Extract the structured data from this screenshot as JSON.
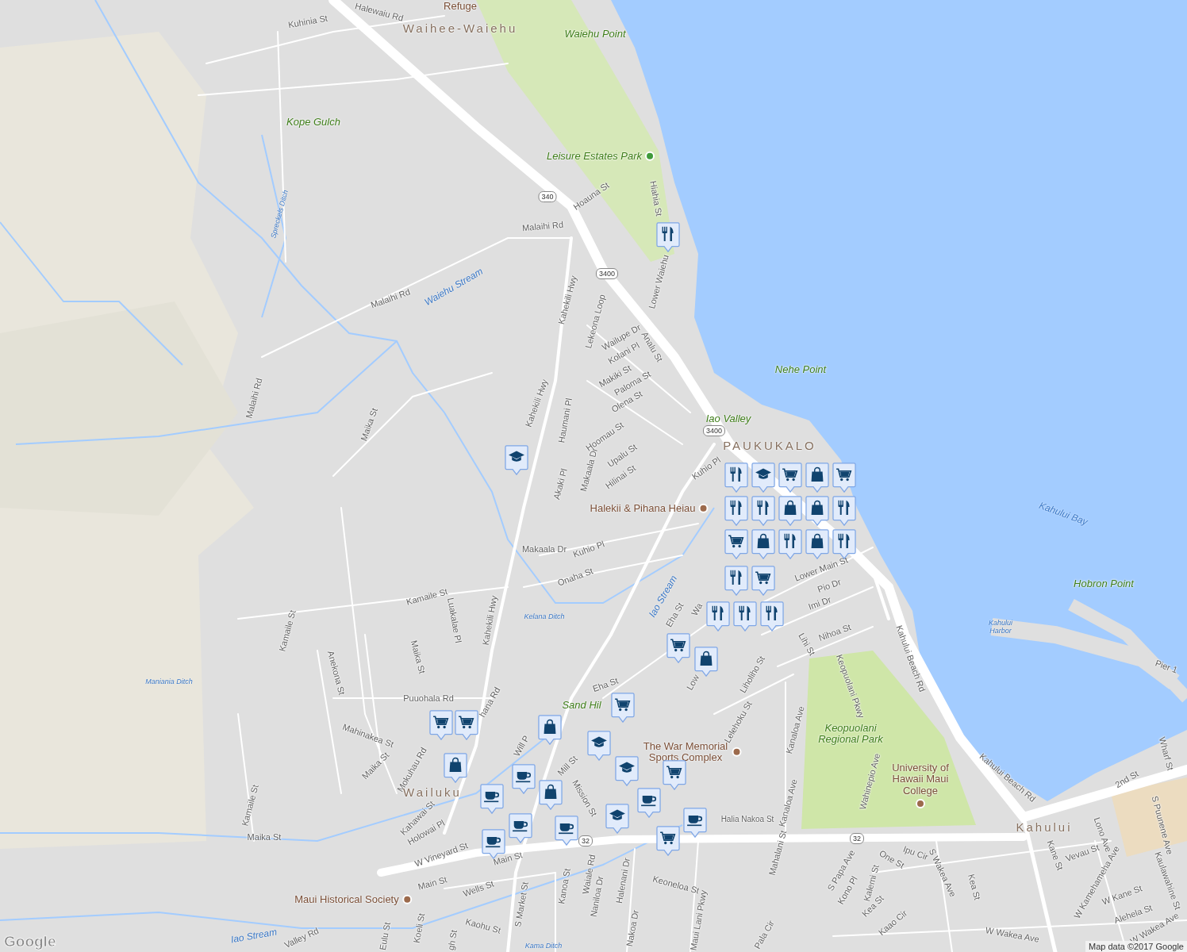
{
  "labels": [
    {
      "kind": "street",
      "text": "Halewaiu Rd"
    },
    {
      "kind": "poi_plain",
      "text": "Refuge"
    },
    {
      "kind": "street",
      "text": "Kuhinia St"
    },
    {
      "kind": "town",
      "text": "Waihee-Waiehu"
    },
    {
      "kind": "park",
      "text": "Waiehu Point"
    },
    {
      "kind": "park",
      "text": "Kope Gulch"
    },
    {
      "kind": "park_poi",
      "text": "Leisure Estates Park"
    },
    {
      "kind": "street",
      "text": "Hoauna St"
    },
    {
      "kind": "street",
      "text": "Hiahia St"
    },
    {
      "kind": "street",
      "text": "Malaihi Rd"
    },
    {
      "kind": "water_small",
      "text": "Spreckels Ditch"
    },
    {
      "kind": "street",
      "text": "Lower Waiehu"
    },
    {
      "kind": "water",
      "text": "Waiehu Stream"
    },
    {
      "kind": "street",
      "text": "Malaihi Rd"
    },
    {
      "kind": "street",
      "text": "Kahekili Hwy"
    },
    {
      "kind": "street",
      "text": "Lekeona Loop"
    },
    {
      "kind": "street",
      "text": "Wailupe Dr"
    },
    {
      "kind": "street",
      "text": "Kolani Pl"
    },
    {
      "kind": "street",
      "text": "Analu St"
    },
    {
      "kind": "park",
      "text": "Nehe Point"
    },
    {
      "kind": "street",
      "text": "Makiki St"
    },
    {
      "kind": "street",
      "text": "Paloma St"
    },
    {
      "kind": "street",
      "text": "Malaihi Rd"
    },
    {
      "kind": "street",
      "text": "Kahekili Hwy"
    },
    {
      "kind": "street",
      "text": "Haumani Pl"
    },
    {
      "kind": "street",
      "text": "Olena St"
    },
    {
      "kind": "park",
      "text": "Iao Valley"
    },
    {
      "kind": "town",
      "text": "PAUKUKALO"
    },
    {
      "kind": "street",
      "text": "Maika St"
    },
    {
      "kind": "street",
      "text": "Hoomau St"
    },
    {
      "kind": "street",
      "text": "Makaala Dr"
    },
    {
      "kind": "street",
      "text": "Upalu St"
    },
    {
      "kind": "street",
      "text": "Kuhio Pl"
    },
    {
      "kind": "street",
      "text": "Hilinai St"
    },
    {
      "kind": "street",
      "text": "Akaki Pl"
    },
    {
      "kind": "poi",
      "text": "Halekii & Pihana Heiau"
    },
    {
      "kind": "water",
      "text": "Kahului Bay"
    },
    {
      "kind": "street",
      "text": "Makaala Dr"
    },
    {
      "kind": "street",
      "text": "Kuhio Pl"
    },
    {
      "kind": "street",
      "text": "Onaha St"
    },
    {
      "kind": "park",
      "text": "Hobron Point"
    },
    {
      "kind": "street",
      "text": "Lower Main St"
    },
    {
      "kind": "street",
      "text": "Pio Dr"
    },
    {
      "kind": "water",
      "text": "Iao Stream"
    },
    {
      "kind": "street",
      "text": "Kamaile St"
    },
    {
      "kind": "street",
      "text": "Eha St"
    },
    {
      "kind": "street",
      "text": "Imi Dr"
    },
    {
      "kind": "water_small",
      "text": "Kelana Ditch"
    },
    {
      "kind": "water_small",
      "text": "Kahului Harbor"
    },
    {
      "kind": "street",
      "text": "Luakalae Pl"
    },
    {
      "kind": "street",
      "text": "Kamaile St"
    },
    {
      "kind": "street",
      "text": "Kahekili Hwy"
    },
    {
      "kind": "street",
      "text": "Nihoa St"
    },
    {
      "kind": "street",
      "text": "Lihi St"
    },
    {
      "kind": "street",
      "text": "Maika St"
    },
    {
      "kind": "street",
      "text": "Anekona St"
    },
    {
      "kind": "street",
      "text": "Kahului Beach Rd"
    },
    {
      "kind": "street",
      "text": "Pier 1"
    },
    {
      "kind": "water_small",
      "text": "Maniania Ditch"
    },
    {
      "kind": "street",
      "text": "Liholiho St"
    },
    {
      "kind": "street",
      "text": "Keopuolani Pkwy"
    },
    {
      "kind": "street",
      "text": "Puuohala Rd"
    },
    {
      "kind": "street",
      "text": "Eha St"
    },
    {
      "kind": "park",
      "text": "Sand Hil"
    },
    {
      "kind": "street",
      "text": "Lelehoku St"
    },
    {
      "kind": "street",
      "text": "Kanaloa Ave"
    },
    {
      "kind": "park",
      "text": "Keopuolani Regional Park"
    },
    {
      "kind": "street",
      "text": "Mahinakea St"
    },
    {
      "kind": "street",
      "text": "Wharf St"
    },
    {
      "kind": "street",
      "text": "Kahului Beach Rd"
    },
    {
      "kind": "poi",
      "text": "The War Memorial Sports Complex"
    },
    {
      "kind": "street",
      "text": "2nd St"
    },
    {
      "kind": "street",
      "text": "Maika St"
    },
    {
      "kind": "street",
      "text": "Mokuhau Rd"
    },
    {
      "kind": "street",
      "text": "Wahinepio Ave"
    },
    {
      "kind": "street",
      "text": "Mill St"
    },
    {
      "kind": "street",
      "text": "Mission St"
    },
    {
      "kind": "town",
      "text": "Wailuku"
    },
    {
      "kind": "poi_below",
      "text": "University of Hawaii Maui College"
    },
    {
      "kind": "street",
      "text": "S Puunene Ave"
    },
    {
      "kind": "street",
      "text": "Kahawai St"
    },
    {
      "kind": "street",
      "text": "Kamaile St"
    },
    {
      "kind": "street_small",
      "text": "Halia Nakoa St"
    },
    {
      "kind": "street",
      "text": "Holowai Pl"
    },
    {
      "kind": "town",
      "text": "Kahului"
    },
    {
      "kind": "street",
      "text": "Lono Ave"
    },
    {
      "kind": "street",
      "text": "Kanaloa Ave"
    },
    {
      "kind": "street",
      "text": "Maika St"
    },
    {
      "kind": "street",
      "text": "Mahalani St"
    },
    {
      "kind": "street",
      "text": "W Vineyard St"
    },
    {
      "kind": "street",
      "text": "Main St"
    },
    {
      "kind": "street",
      "text": "Vevau St"
    },
    {
      "kind": "street",
      "text": "S Papa Ave"
    },
    {
      "kind": "street",
      "text": "One St"
    },
    {
      "kind": "street",
      "text": "Ipu Cir"
    },
    {
      "kind": "street",
      "text": "Kono Pl"
    },
    {
      "kind": "street",
      "text": "Kalemi St"
    },
    {
      "kind": "street",
      "text": "Kane St"
    },
    {
      "kind": "street",
      "text": "W Kamehameha Ave"
    },
    {
      "kind": "street",
      "text": "Kaulawahine St"
    },
    {
      "kind": "street",
      "text": "Main St"
    },
    {
      "kind": "street",
      "text": "Wells St"
    },
    {
      "kind": "street",
      "text": "S Market St"
    },
    {
      "kind": "street",
      "text": "Waiale Rd"
    },
    {
      "kind": "street",
      "text": "Kanoa St"
    },
    {
      "kind": "street",
      "text": "Naniloa Dr"
    },
    {
      "kind": "street",
      "text": "Halenani Dr"
    },
    {
      "kind": "street",
      "text": "Keoneloa St"
    },
    {
      "kind": "street",
      "text": "W Kane St"
    },
    {
      "kind": "street",
      "text": "Kea St"
    },
    {
      "kind": "street",
      "text": "Kea St"
    },
    {
      "kind": "street",
      "text": "S Wakea Ave"
    },
    {
      "kind": "street",
      "text": "Alehela St"
    },
    {
      "kind": "poi",
      "text": "Maui Historical Society"
    },
    {
      "kind": "street",
      "text": "Kaohu St"
    },
    {
      "kind": "street",
      "text": "Kaao Cir"
    },
    {
      "kind": "street",
      "text": "Nakoa Dr"
    },
    {
      "kind": "street",
      "text": "Maui Lani Pkwy"
    },
    {
      "kind": "street",
      "text": "W Wakea Ave"
    },
    {
      "kind": "street",
      "text": "W Wakea Ave"
    },
    {
      "kind": "water",
      "text": "Iao Stream"
    },
    {
      "kind": "street",
      "text": "Valley Rd"
    },
    {
      "kind": "street",
      "text": "Eulu St"
    },
    {
      "kind": "street",
      "text": "Koeli St"
    },
    {
      "kind": "water_small",
      "text": "Kama Ditch"
    },
    {
      "kind": "street",
      "text": "Pala Cir"
    },
    {
      "kind": "street",
      "text": "Will P"
    },
    {
      "kind": "street",
      "text": "hana Rd"
    },
    {
      "kind": "street",
      "text": "Low"
    },
    {
      "kind": "street",
      "text": "gh St"
    },
    {
      "kind": "street",
      "text": "Wa"
    }
  ],
  "shields": [
    {
      "text": "340"
    },
    {
      "text": "3400"
    },
    {
      "text": "3400"
    },
    {
      "text": "32"
    },
    {
      "text": "32"
    }
  ],
  "pins": [
    {
      "kind": "restaurant"
    },
    {
      "kind": "school"
    },
    {
      "kind": "restaurant"
    },
    {
      "kind": "school"
    },
    {
      "kind": "grocery"
    },
    {
      "kind": "shopping"
    },
    {
      "kind": "grocery"
    },
    {
      "kind": "restaurant"
    },
    {
      "kind": "restaurant"
    },
    {
      "kind": "shopping"
    },
    {
      "kind": "shopping"
    },
    {
      "kind": "restaurant"
    },
    {
      "kind": "grocery"
    },
    {
      "kind": "shopping"
    },
    {
      "kind": "restaurant"
    },
    {
      "kind": "shopping"
    },
    {
      "kind": "restaurant"
    },
    {
      "kind": "restaurant"
    },
    {
      "kind": "grocery"
    },
    {
      "kind": "restaurant"
    },
    {
      "kind": "restaurant"
    },
    {
      "kind": "restaurant"
    },
    {
      "kind": "grocery"
    },
    {
      "kind": "shopping"
    },
    {
      "kind": "grocery"
    },
    {
      "kind": "grocery"
    },
    {
      "kind": "grocery"
    },
    {
      "kind": "shopping"
    },
    {
      "kind": "school"
    },
    {
      "kind": "school"
    },
    {
      "kind": "shopping"
    },
    {
      "kind": "cafe"
    },
    {
      "kind": "grocery"
    },
    {
      "kind": "cafe"
    },
    {
      "kind": "shopping"
    },
    {
      "kind": "cafe"
    },
    {
      "kind": "school"
    },
    {
      "kind": "cafe"
    },
    {
      "kind": "cafe"
    },
    {
      "kind": "cafe"
    },
    {
      "kind": "cafe"
    },
    {
      "kind": "grocery"
    }
  ],
  "logo": "Google",
  "attribution": "Map data ©2017 Google"
}
